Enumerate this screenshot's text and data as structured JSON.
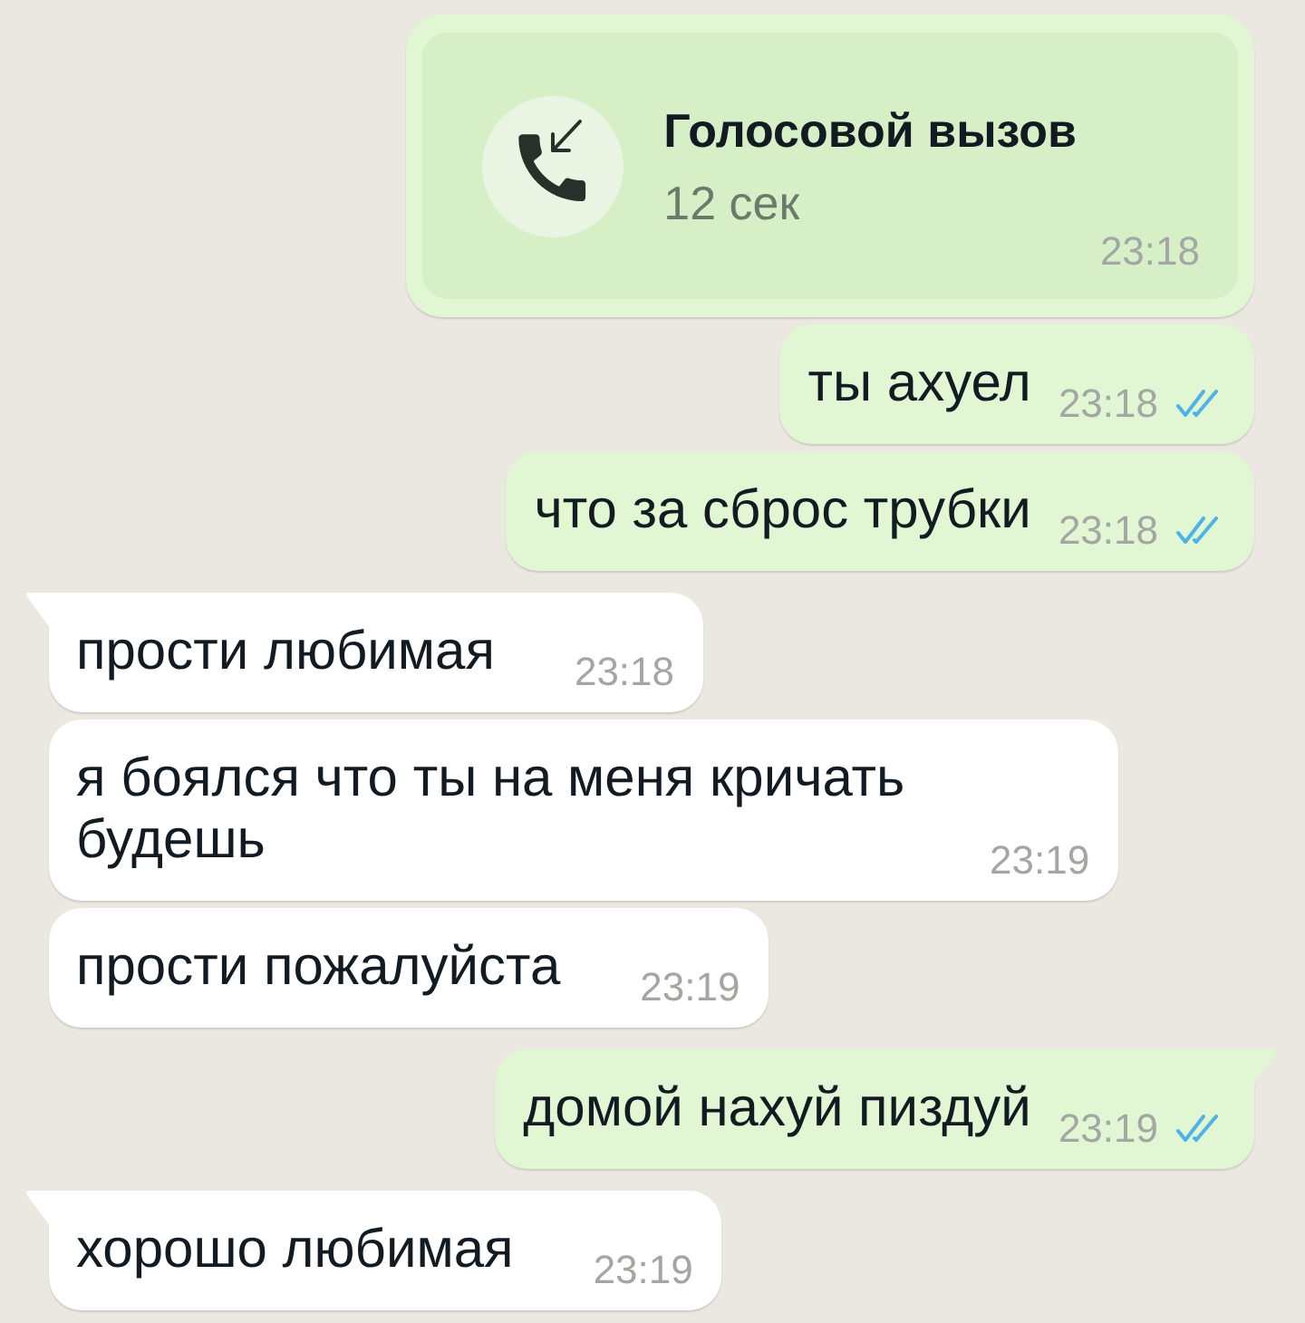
{
  "messages": [
    {
      "kind": "call",
      "outgoing": true,
      "tail": false,
      "title": "Голосовой вызов",
      "duration": "12 сек",
      "time": "23:18"
    },
    {
      "kind": "text",
      "outgoing": true,
      "tail": false,
      "text": "ты ахуел",
      "time": "23:18",
      "read": true
    },
    {
      "kind": "text",
      "outgoing": true,
      "tail": false,
      "text": "что за сброс трубки",
      "time": "23:18",
      "read": true
    },
    {
      "kind": "text",
      "outgoing": false,
      "tail": true,
      "text": "прости любимая",
      "time": "23:18"
    },
    {
      "kind": "text",
      "outgoing": false,
      "tail": false,
      "text": "я боялся что ты на меня кричать будешь",
      "time": "23:19"
    },
    {
      "kind": "text",
      "outgoing": false,
      "tail": false,
      "text": "прости пожалуйста",
      "time": "23:19"
    },
    {
      "kind": "text",
      "outgoing": true,
      "tail": true,
      "text": "домой нахуй пиздуй",
      "time": "23:19",
      "read": true
    },
    {
      "kind": "text",
      "outgoing": false,
      "tail": true,
      "text": "хорошо любимая",
      "time": "23:19"
    }
  ]
}
